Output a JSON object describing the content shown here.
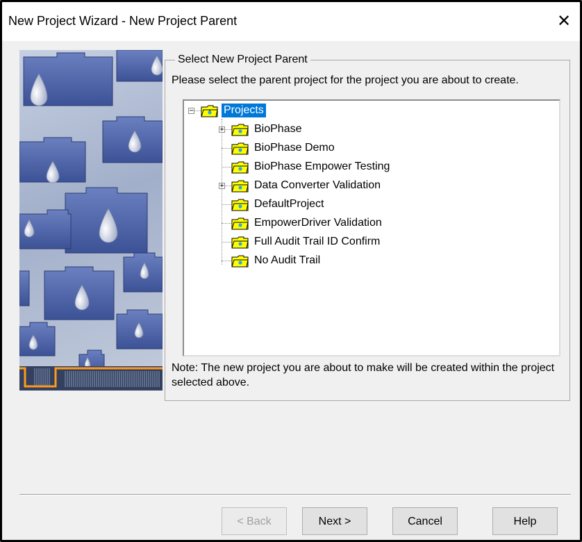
{
  "window": {
    "title": "New Project Wizard - New Project Parent",
    "close_glyph": "✕"
  },
  "group": {
    "legend": "Select New Project Parent",
    "instruction": "Please select the parent project for the project you are about to create.",
    "note": "Note: The new project you are about to make will be created within the project selected above."
  },
  "tree": {
    "root": {
      "label": "Projects",
      "expanded": true,
      "selected": true
    },
    "children": [
      {
        "label": "BioPhase",
        "has_children": true
      },
      {
        "label": "BioPhase Demo",
        "has_children": false
      },
      {
        "label": "BioPhase Empower Testing",
        "has_children": false
      },
      {
        "label": "Data Converter Validation",
        "has_children": true
      },
      {
        "label": "DefaultProject",
        "has_children": false
      },
      {
        "label": "EmpowerDriver Validation",
        "has_children": false
      },
      {
        "label": "Full Audit Trail ID Confirm",
        "has_children": false
      },
      {
        "label": "No Audit Trail",
        "has_children": false
      }
    ],
    "folder_icon": "project-folder-icon",
    "expand_glyph": "+",
    "collapse_glyph": "−"
  },
  "buttons": {
    "back": "< Back",
    "next": "Next >",
    "cancel": "Cancel",
    "help": "Help"
  },
  "colors": {
    "selection": "#0078d7",
    "folder_fill": "#ffff00",
    "art_folder": "#4a62a6"
  }
}
